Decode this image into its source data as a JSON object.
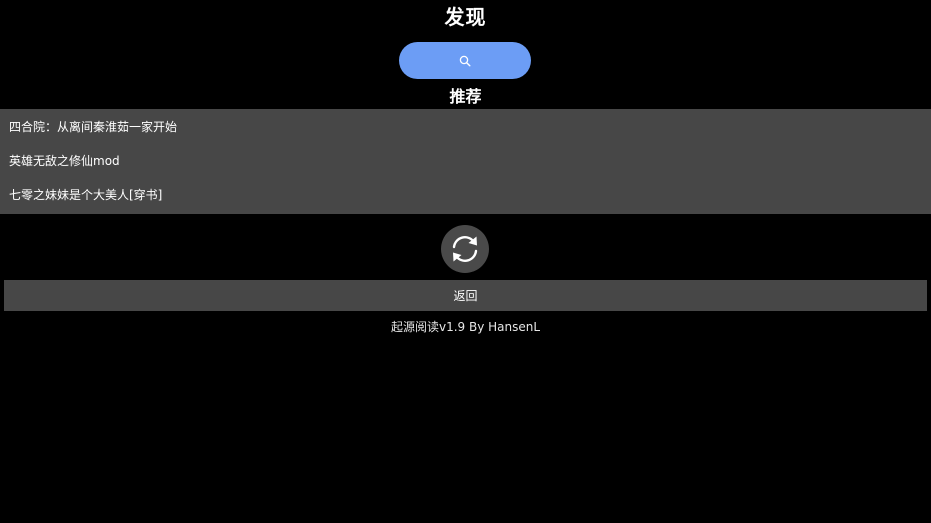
{
  "header": {
    "title": "发现"
  },
  "search": {
    "icon": "search-icon",
    "color": "#6c9df5"
  },
  "recommend": {
    "title": "推荐",
    "items": [
      {
        "label": "四合院：从离间秦淮茹一家开始"
      },
      {
        "label": "英雄无敌之修仙mod"
      },
      {
        "label": "七零之妹妹是个大美人[穿书]"
      }
    ]
  },
  "refresh": {
    "icon": "refresh-icon"
  },
  "back": {
    "label": "返回"
  },
  "footer": {
    "text": "起源阅读v1.9  By HansenL"
  }
}
